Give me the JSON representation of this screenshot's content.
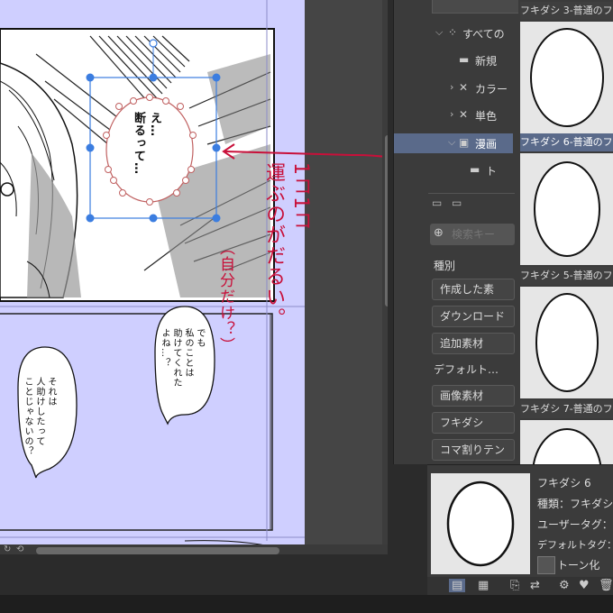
{
  "canvas": {
    "panel1_bubble": "え…\n断るって…",
    "panel2_bubble_right": "でも\n私のことは\n助けてくれた\nよね…？",
    "panel2_bubble_left": "それは\n人助けしたって\nことじゃないの？",
    "annotation_main": "1コ1コ\n運ぶのがだるい。",
    "annotation_side": "（自分だけ？）"
  },
  "material_tree": [
    {
      "label": "すべての",
      "icon": "grid-icon",
      "chevron": "⌵"
    },
    {
      "label": "新規",
      "icon": "folder-icon",
      "chevron": ""
    },
    {
      "label": "カラー",
      "icon": "cross-icon",
      "chevron": "›"
    },
    {
      "label": "単色",
      "icon": "cross-icon",
      "chevron": "›"
    },
    {
      "label": "漫画",
      "icon": "frame-icon",
      "chevron": "⌵"
    },
    {
      "label": "ト",
      "icon": "folder-icon",
      "chevron": ""
    }
  ],
  "search": {
    "placeholder": "検索キー"
  },
  "categories": {
    "label_kind": "種別",
    "items_kind": [
      "作成した素",
      "ダウンロード",
      "追加素材"
    ],
    "label_default": "デフォルト…",
    "items_default": [
      "画像素材",
      "フキダシ",
      "コマ割りテン"
    ]
  },
  "thumbnails": [
    {
      "label": "フキダシ 3-普通のフ"
    },
    {
      "label": "フキダシ 6-普通のフ"
    },
    {
      "label": "フキダシ 5-普通のフ"
    },
    {
      "label": "フキダシ 7-普通のフ"
    }
  ],
  "detail": {
    "name": "フキダシ 6",
    "type": "種類：フキダシ",
    "user_tag": "ユーザータグ：",
    "default_tag": "デフォルトタグ：フキ",
    "tone_label": "トーン化"
  },
  "colors": {
    "accent_selection": "#5a6a8a",
    "transform_handle": "#3b7de0",
    "page_blue": "#cfcfff",
    "annotation_red": "#c8103a"
  }
}
